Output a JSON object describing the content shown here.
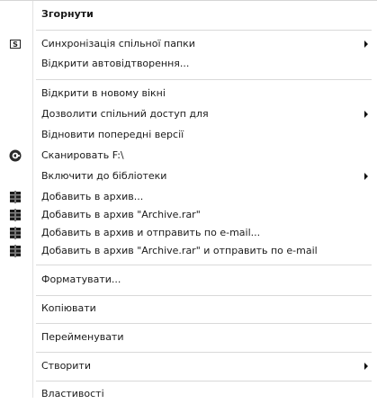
{
  "menu": {
    "collapse": "Згорнути",
    "sync_folder": "Синхронізація спільної папки",
    "open_autoplay": "Відкрити автовідтворення...",
    "open_new_window": "Відкрити в новому вікні",
    "share_with": "Дозволити спільний доступ для",
    "restore_previous": "Відновити попередні версії",
    "scan": "Сканировать F:\\",
    "include_library": "Включити до бібліотеки",
    "add_archive": "Добавить в архив...",
    "add_archive_rar": "Добавить в архив \"Archive.rar\"",
    "add_archive_email": "Добавить в архив и отправить по e-mail...",
    "add_archive_rar_email": "Добавить в архив \"Archive.rar\" и отправить по e-mail",
    "format": "Форматувати...",
    "copy": "Копіювати",
    "rename": "Перейменувати",
    "create": "Створити",
    "properties": "Властивості"
  },
  "icons": {
    "sync_folder": "sync-folder-icon",
    "scan": "antivirus-scan-icon",
    "archive": "winrar-archive-icon"
  },
  "colors": {
    "background": "#ffffff",
    "text": "#1a1a1a",
    "separator": "#d9d9d9"
  }
}
